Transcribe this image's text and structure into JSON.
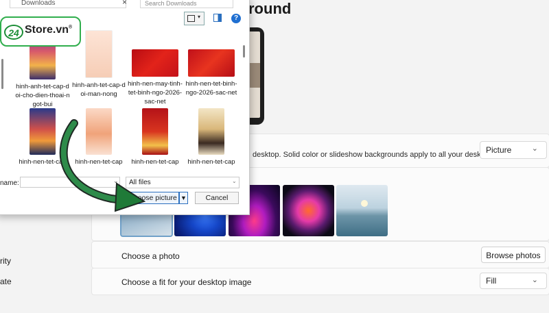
{
  "settings": {
    "title_partial": "round",
    "background_desc": "desktop. Solid color or slideshow backgrounds apply to all your desktops.",
    "background_type": "Picture",
    "choose_photo_label": "Choose a photo",
    "browse_label": "Browse photos",
    "fit_label": "Choose a fit for your desktop image",
    "fit_value": "Fill"
  },
  "nav": {
    "item_1": "rity",
    "item_2": "ate"
  },
  "dialog": {
    "path_partial": "Downloads",
    "search_placeholder": "Search Downloads",
    "help": "?",
    "files": [
      {
        "name": "hinh-anh-tet-cap-doi-cho-dien-thoai-ngot-bui"
      },
      {
        "name": "hinh-anh-tet-cap-doi-man-nong"
      },
      {
        "name": "hinh-nen-may-tinh-tet-binh-ngo-2026-sac-net"
      },
      {
        "name": "hinh-nen-tet-binh-ngo-2026-sac-net"
      },
      {
        "name": "hinh-nen-tet-cap"
      },
      {
        "name": "hinh-nen-tet-cap"
      },
      {
        "name": "hinh-nen-tet-cap"
      },
      {
        "name": "hinh-nen-tet-cap"
      }
    ],
    "filename_label": "name:",
    "filename_value": "",
    "filter_value": "All files",
    "choose_label": "Choose picture",
    "cancel_label": "Cancel"
  },
  "logo": {
    "badge": "24",
    "text": "Store.vn",
    "reg": "®"
  },
  "colors": {
    "accent": "#2a6fbf",
    "logo_green": "#2fae4c",
    "arrow_green": "#1f7a38"
  }
}
